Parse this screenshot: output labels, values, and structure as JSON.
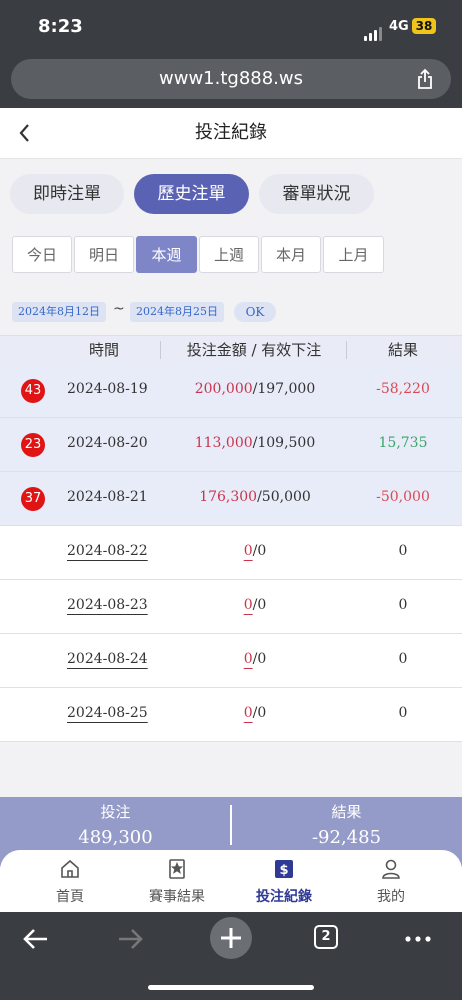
{
  "status": {
    "time": "8:23",
    "network": "4G",
    "battery": "38"
  },
  "browser": {
    "url": "www1.tg888.ws",
    "tab_count": "2"
  },
  "header": {
    "title": "投注紀錄"
  },
  "main_tabs": [
    {
      "label": "即時注單",
      "active": false
    },
    {
      "label": "歷史注單",
      "active": true
    },
    {
      "label": "審單狀況",
      "active": false
    }
  ],
  "period_tabs": [
    {
      "label": "今日",
      "active": false
    },
    {
      "label": "明日",
      "active": false
    },
    {
      "label": "本週",
      "active": true
    },
    {
      "label": "上週",
      "active": false
    },
    {
      "label": "本月",
      "active": false
    },
    {
      "label": "上月",
      "active": false
    }
  ],
  "date_range": {
    "start": "2024年8月12日",
    "separator": "~",
    "end": "2024年8月25日",
    "ok_label": "OK"
  },
  "table": {
    "headers": [
      "時間",
      "投注金額 / 有效下注",
      "結果"
    ],
    "rows": [
      {
        "count": "43",
        "date": "2024-08-19",
        "bet": "200,000",
        "valid": "/197,000",
        "result": "-58,220"
      },
      {
        "count": "23",
        "date": "2024-08-20",
        "bet": "113,000",
        "valid": "/109,500",
        "result": "15,735"
      },
      {
        "count": "37",
        "date": "2024-08-21",
        "bet": "176,300",
        "valid": "/50,000",
        "result": "-50,000"
      },
      {
        "count": "",
        "date": "2024-08-22",
        "bet": "0",
        "valid": "/0",
        "result": "0"
      },
      {
        "count": "",
        "date": "2024-08-23",
        "bet": "0",
        "valid": "/0",
        "result": "0"
      },
      {
        "count": "",
        "date": "2024-08-24",
        "bet": "0",
        "valid": "/0",
        "result": "0"
      },
      {
        "count": "",
        "date": "2024-08-25",
        "bet": "0",
        "valid": "/0",
        "result": "0"
      }
    ]
  },
  "summary": {
    "bet_label": "投注",
    "bet_value": "489,300",
    "result_label": "結果",
    "result_value": "-92,485"
  },
  "bottom_nav": [
    {
      "label": "首頁",
      "icon": "home-icon",
      "active": false
    },
    {
      "label": "賽事結果",
      "icon": "bookmark-star-icon",
      "active": false
    },
    {
      "label": "投注紀錄",
      "icon": "bet-record-icon",
      "active": true
    },
    {
      "label": "我的",
      "icon": "user-icon",
      "active": false
    }
  ],
  "colors": {
    "accent": "#5a62b3",
    "negative": "#d84b55",
    "positive": "#3da56b",
    "badge": "#e01414"
  }
}
